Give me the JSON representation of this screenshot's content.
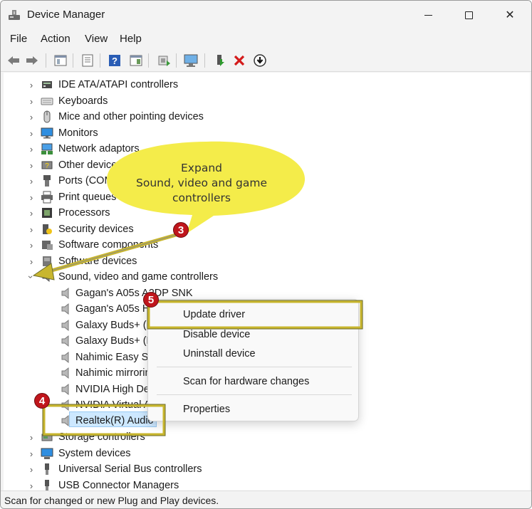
{
  "window": {
    "title": "Device Manager",
    "controls": {
      "minimize": "",
      "maximize": "",
      "close": "✕"
    }
  },
  "menu": [
    "File",
    "Action",
    "View",
    "Help"
  ],
  "toolbar": {
    "icons": [
      "back-icon",
      "forward-icon",
      "properties-icon",
      "show-hidden-icon",
      "help-icon",
      "view-icon",
      "update-driver-icon",
      "scan-hardware-icon",
      "add-driver-icon",
      "uninstall-icon",
      "disable-icon"
    ]
  },
  "tree": {
    "categories_top": [
      {
        "label": "IDE ATA/ATAPI controllers",
        "icon": "ide-controller-icon"
      },
      {
        "label": "Keyboards",
        "icon": "keyboard-icon"
      },
      {
        "label": "Mice and other pointing devices",
        "icon": "mouse-icon"
      },
      {
        "label": "Monitors",
        "icon": "monitor-icon"
      },
      {
        "label": "Network adaptors",
        "icon": "network-adapter-icon"
      },
      {
        "label": "Other devices",
        "icon": "other-devices-icon"
      },
      {
        "label": "Ports (COM & LPT)",
        "icon": "ports-icon"
      },
      {
        "label": "Print queues",
        "icon": "printer-icon"
      },
      {
        "label": "Processors",
        "icon": "processor-icon"
      },
      {
        "label": "Security devices",
        "icon": "security-device-icon"
      },
      {
        "label": "Software components",
        "icon": "software-component-icon"
      },
      {
        "label": "Software devices",
        "icon": "software-device-icon"
      }
    ],
    "expanded_category": {
      "label": "Sound, video and game controllers",
      "icon": "sound-icon"
    },
    "children": [
      "Gagan's A05s A2DP SNK",
      "Gagan's A05s Hands-Free",
      "Galaxy Buds+ (D",
      "Galaxy Buds+ (D",
      "Nahimic Easy Su",
      "Nahimic mirrorin",
      "NVIDIA High Def",
      "NVIDIA Virtual A",
      "Realtek(R) Audio"
    ],
    "categories_bottom": [
      {
        "label": "Storage controllers",
        "icon": "storage-icon"
      },
      {
        "label": "System devices",
        "icon": "system-devices-icon"
      },
      {
        "label": "Universal Serial Bus controllers",
        "icon": "usb-icon"
      },
      {
        "label": "USB Connector Managers",
        "icon": "usb-connector-icon"
      }
    ]
  },
  "context_menu": {
    "items": [
      "Update driver",
      "Disable device",
      "Uninstall device",
      "Scan for hardware changes",
      "Properties"
    ]
  },
  "annotation": {
    "callout": {
      "line1": "Expand",
      "line2": "Sound, video and game controllers"
    },
    "badges": {
      "step3": "3",
      "step4": "4",
      "step5": "5"
    }
  },
  "status": {
    "text": "Scan for changed or new Plug and Play devices."
  },
  "colors": {
    "highlight": "#c8b62e",
    "callout_fill": "#f4ec4a",
    "badge": "#c0161c",
    "selection": "#cde8ff"
  }
}
